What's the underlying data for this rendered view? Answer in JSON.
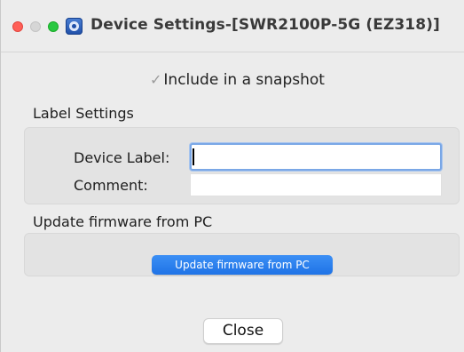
{
  "window": {
    "title": "Device Settings-[SWR2100P-5G (EZ318)]"
  },
  "snapshot": {
    "checkmark": "✓",
    "label": "Include in a snapshot"
  },
  "label_settings": {
    "heading": "Label Settings",
    "device_label": "Device Label:",
    "device_label_value": "",
    "comment": "Comment:",
    "comment_value": ""
  },
  "firmware": {
    "heading": "Update firmware from PC",
    "button_label": "Update firmware from PC"
  },
  "footer": {
    "close_label": "Close"
  },
  "colors": {
    "accent": "#1f73e6",
    "close_dot": "#ff5f57",
    "max_dot": "#28c840"
  }
}
